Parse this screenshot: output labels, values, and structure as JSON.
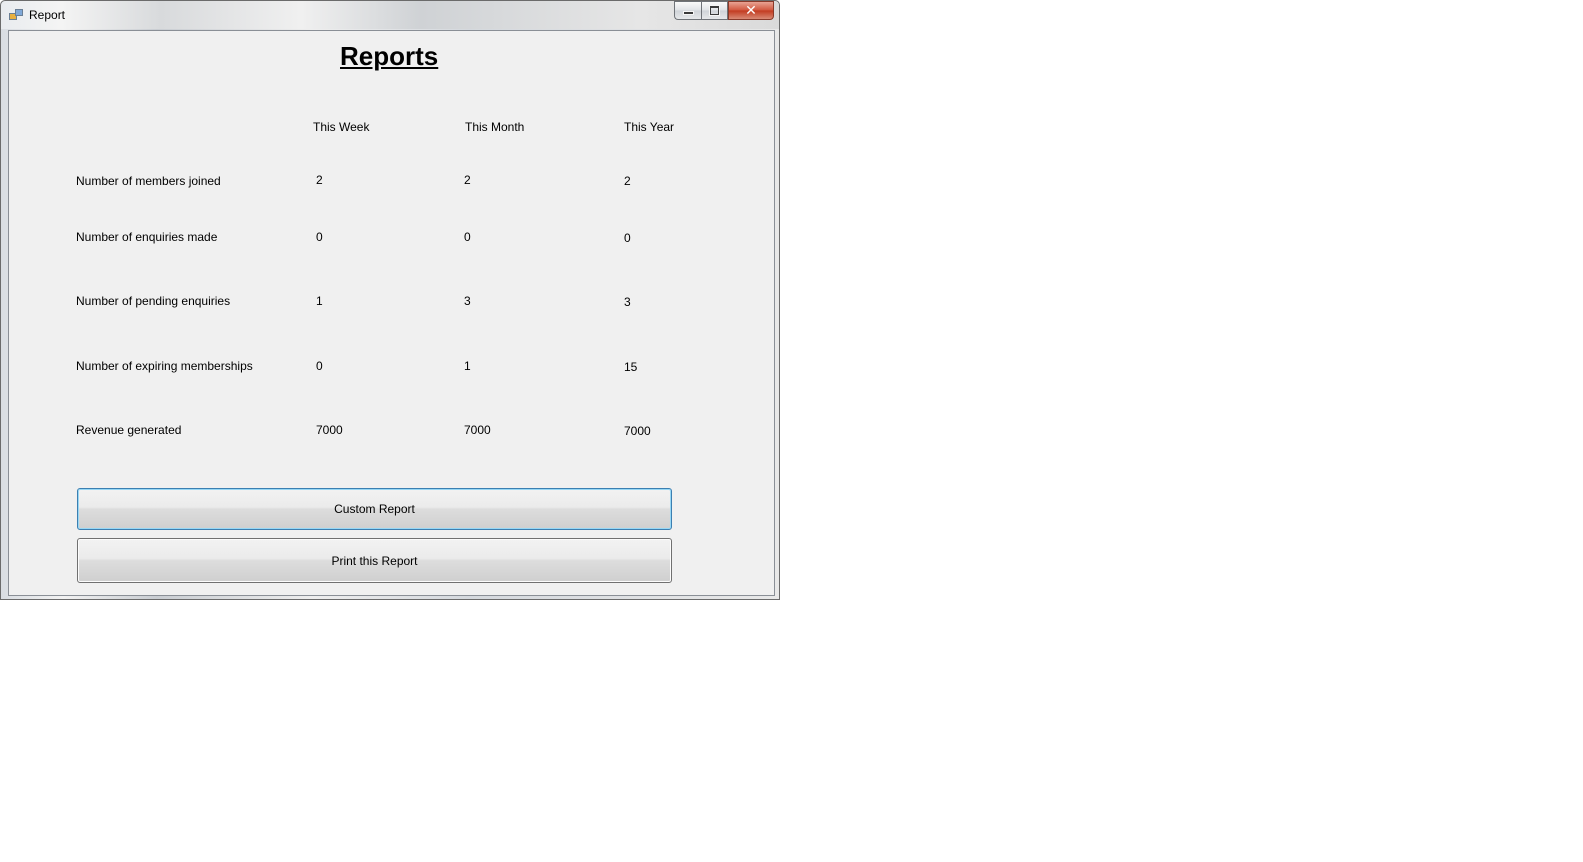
{
  "window": {
    "title": "Report",
    "controls": {
      "minimize": "minimize-icon",
      "maximize": "maximize-icon",
      "close": "✕"
    }
  },
  "report": {
    "heading": "Reports",
    "columns": [
      "This Week",
      "This Month",
      "This Year"
    ],
    "rows": [
      {
        "label": "Number of members joined",
        "values": [
          "2",
          "2",
          "2"
        ]
      },
      {
        "label": "Number of enquiries made",
        "values": [
          "0",
          "0",
          "0"
        ]
      },
      {
        "label": "Number of pending enquiries",
        "values": [
          "1",
          "3",
          "3"
        ]
      },
      {
        "label": "Number of expiring memberships",
        "values": [
          "0",
          "1",
          "15"
        ]
      },
      {
        "label": "Revenue generated",
        "values": [
          "7000",
          "7000",
          "7000"
        ]
      }
    ]
  },
  "buttons": {
    "custom_report": "Custom Report",
    "print_report": "Print this Report"
  }
}
